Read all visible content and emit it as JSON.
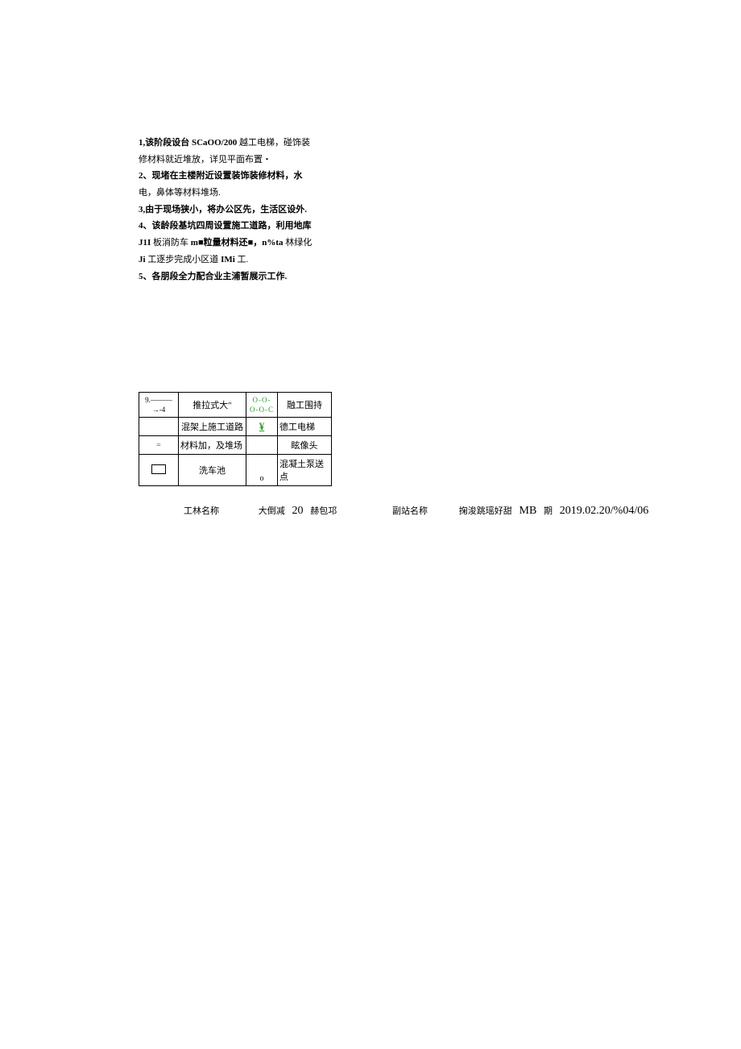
{
  "notes": {
    "line1a": "1,该阶段设台",
    "line1b": "SCaOO/200",
    "line1c": "越工电梯，碰饰装",
    "line2": "修材料就近堆放，详见平面布置・",
    "line3": "2、现堵在主楼附近设置装饰装修材料，水",
    "line4": "电，鼻体等材料堆场.",
    "line5": "3,由于现场狭小，将办公区先，生活区设外.",
    "line6": "4、该龄段基坑四周设置施工道路，利用地库",
    "line7a": "J1I",
    "line7b": "板消防车",
    "line7c": "m■粒量材料还■，n%ta",
    "line7d": "林绿化",
    "line8a": "Ji",
    "line8b": "工逐步完成小区道",
    "line8c": "IMi",
    "line8d": "工.",
    "line9": "5、各朋段全力配合业主浦暂展示工作."
  },
  "legend": {
    "r1": {
      "s1": "9.———→-4",
      "t1": "推拉式大\"",
      "s2": "O-O-O-O-C",
      "t2": "融工围持"
    },
    "r2": {
      "s1": "",
      "t1": "混架上施工道路",
      "s2": "¥",
      "t2": "德工电梯"
    },
    "r3": {
      "s1": "=",
      "t1": "材料加，及堆场",
      "s2": "",
      "t2": "眩像头"
    },
    "r4": {
      "s1": "box",
      "t1": "洗车池",
      "s2": "o",
      "t2": "混凝土泵送点"
    }
  },
  "footer": {
    "label1": "工林名称",
    "val1a": "大倒减",
    "val1b": "20",
    "val1c": "赫包邛",
    "label2": "副站名称",
    "val2a": "掬浚跳瑶好甜",
    "val2b": "MB",
    "val2c": "期",
    "val2d": "2019.02.20/%04/06"
  }
}
